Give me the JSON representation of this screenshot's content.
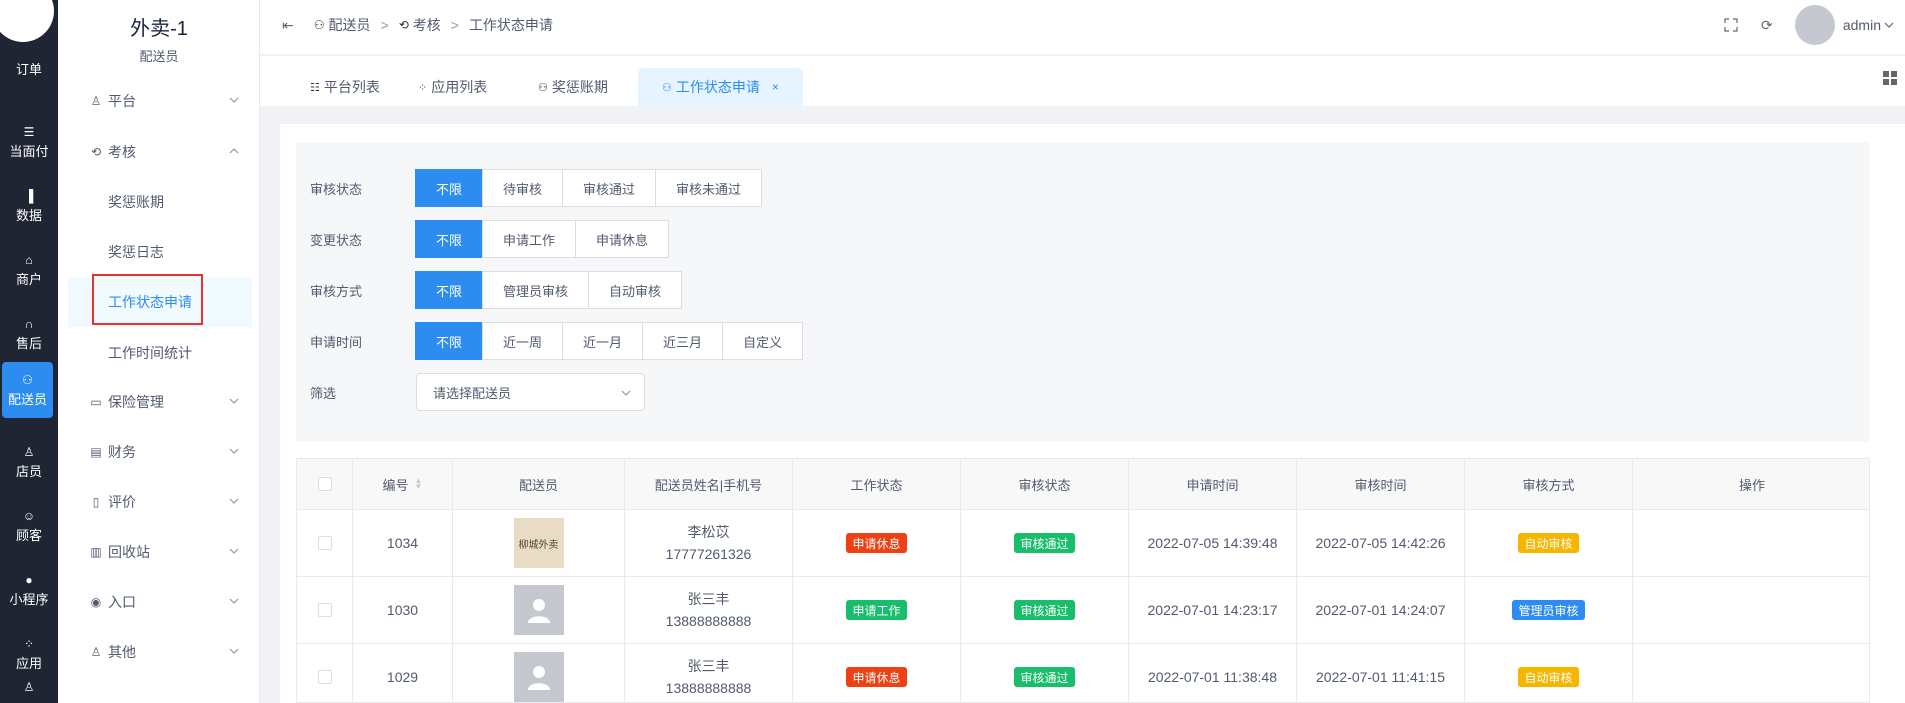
{
  "app": {
    "title": "外卖-1",
    "subtitle": "配送员"
  },
  "rail": {
    "items": [
      {
        "label": "订单",
        "icon": "order-icon"
      },
      {
        "label": "当面付",
        "icon": "list-icon"
      },
      {
        "label": "数据",
        "icon": "bar-chart-icon"
      },
      {
        "label": "商户",
        "icon": "store-icon"
      },
      {
        "label": "售后",
        "icon": "headset-icon"
      },
      {
        "label": "配送员",
        "icon": "scooter-icon"
      },
      {
        "label": "店员",
        "icon": "staff-icon"
      },
      {
        "label": "顾客",
        "icon": "customer-icon"
      },
      {
        "label": "小程序",
        "icon": "wechat-icon"
      },
      {
        "label": "应用",
        "icon": "apps-icon"
      }
    ]
  },
  "sidebar": {
    "menus": [
      {
        "label": "平台",
        "icon": "users-icon"
      },
      {
        "label": "考核",
        "icon": "refresh-icon"
      },
      {
        "label": "保险管理",
        "icon": "laptop-icon"
      },
      {
        "label": "财务",
        "icon": "finance-icon"
      },
      {
        "label": "评价",
        "icon": "document-icon"
      },
      {
        "label": "回收站",
        "icon": "trash-icon"
      },
      {
        "label": "入口",
        "icon": "entry-icon"
      },
      {
        "label": "其他",
        "icon": "user-other-icon"
      }
    ],
    "sub": [
      "奖惩账期",
      "奖惩日志",
      "工作状态申请",
      "工作时间统计"
    ]
  },
  "breadcrumb": {
    "items": [
      "配送员",
      "考核",
      "工作状态申请"
    ],
    "sep": ">"
  },
  "header": {
    "user": "admin"
  },
  "tabs": [
    {
      "label": "平台列表",
      "icon": "list-icon"
    },
    {
      "label": "应用列表",
      "icon": "apps-icon"
    },
    {
      "label": "奖惩账期",
      "icon": "scooter-icon"
    },
    {
      "label": "工作状态申请",
      "icon": "scooter-icon",
      "close": "×"
    }
  ],
  "filters": {
    "audit_status": {
      "label": "审核状态",
      "options": [
        "不限",
        "待审核",
        "审核通过",
        "审核未通过"
      ],
      "selected": 0
    },
    "change_status": {
      "label": "变更状态",
      "options": [
        "不限",
        "申请工作",
        "申请休息"
      ],
      "selected": 0
    },
    "audit_method": {
      "label": "审核方式",
      "options": [
        "不限",
        "管理员审核",
        "自动审核"
      ],
      "selected": 0
    },
    "apply_time": {
      "label": "申请时间",
      "options": [
        "不限",
        "近一周",
        "近一月",
        "近三月",
        "自定义"
      ],
      "selected": 0
    },
    "screen": {
      "label": "筛选",
      "placeholder": "请选择配送员"
    }
  },
  "table": {
    "headers": [
      "编号",
      "配送员",
      "配送员姓名|手机号",
      "工作状态",
      "审核状态",
      "申请时间",
      "审核时间",
      "审核方式",
      "操作"
    ],
    "rows": [
      {
        "id": "1034",
        "avatar_text": "柳城外卖",
        "name": "李松苡",
        "phone": "17777261326",
        "work_status": "申请休息",
        "work_color": "#ed4014",
        "audit_status": "审核通过",
        "audit_color": "#19be6b",
        "apply_time": "2022-07-05 14:39:48",
        "audit_time": "2022-07-05 14:42:26",
        "method": "自动审核",
        "method_color": "#f7b500"
      },
      {
        "id": "1030",
        "avatar_text": "",
        "name": "张三丰",
        "phone": "13888888888",
        "work_status": "申请工作",
        "work_color": "#19be6b",
        "audit_status": "审核通过",
        "audit_color": "#19be6b",
        "apply_time": "2022-07-01 14:23:17",
        "audit_time": "2022-07-01 14:24:07",
        "method": "管理员审核",
        "method_color": "#2d8cf0"
      },
      {
        "id": "1029",
        "avatar_text": "",
        "name": "张三丰",
        "phone": "13888888888",
        "work_status": "申请休息",
        "work_color": "#ed4014",
        "audit_status": "审核通过",
        "audit_color": "#19be6b",
        "apply_time": "2022-07-01 11:38:48",
        "audit_time": "2022-07-01 11:41:15",
        "method": "自动审核",
        "method_color": "#f7b500"
      }
    ]
  }
}
